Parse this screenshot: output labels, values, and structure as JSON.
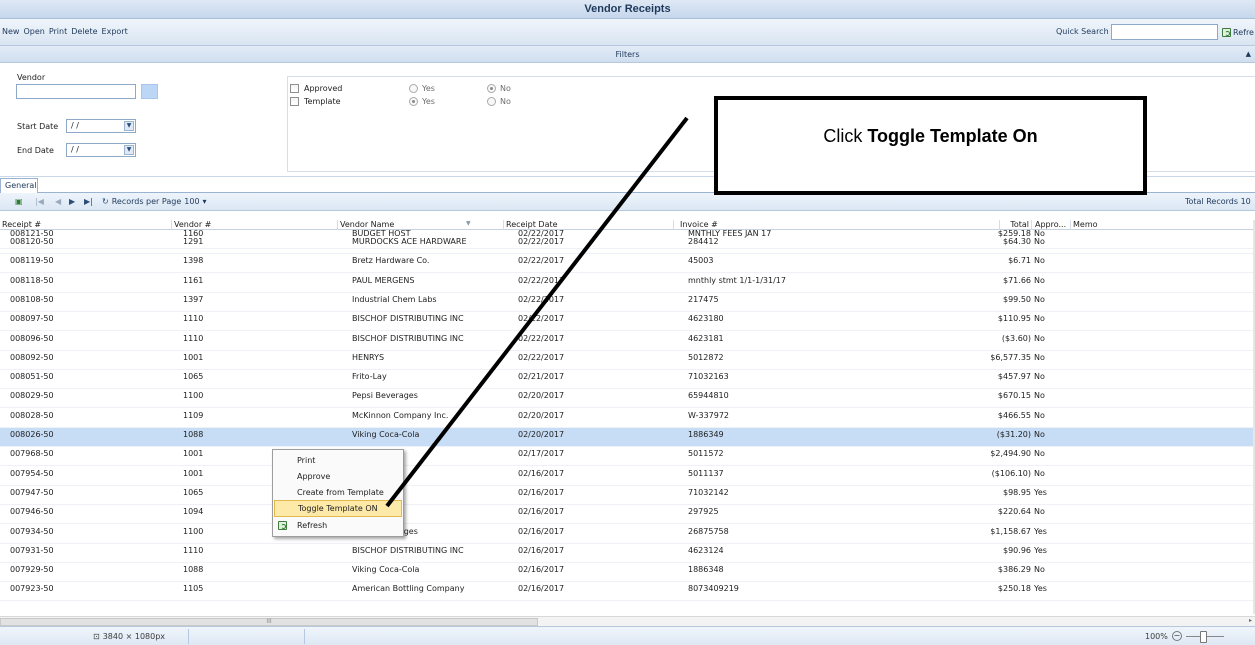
{
  "window": {
    "title": "Vendor Receipts"
  },
  "toolbar": {
    "menu": [
      "New",
      "Open",
      "Print",
      "Delete",
      "Export"
    ],
    "quick_search_label": "Quick Search",
    "quick_search_value": "",
    "refresh_label": "Refre"
  },
  "filters": {
    "header": "Filters",
    "vendor_label": "Vendor",
    "vendor_value": "",
    "start_date_label": "Start Date",
    "start_date_value": "/ /",
    "end_date_label": "End Date",
    "end_date_value": "/ /",
    "approved": {
      "label": "Approved",
      "checked": false,
      "yes": "Yes",
      "no": "No",
      "selected": "No"
    },
    "template": {
      "label": "Template",
      "checked": false,
      "yes": "Yes",
      "no": "No",
      "selected": "Yes"
    }
  },
  "tabs": [
    "General"
  ],
  "navigator": {
    "records_per_page_label": "Records per Page",
    "records_per_page_value": "100",
    "total_records": "Total Records 10"
  },
  "grid": {
    "columns": [
      "Receipt #",
      "Vendor #",
      "Vendor Name",
      "Receipt Date",
      "Invoice #",
      "Total",
      "Appro...",
      "Memo"
    ],
    "rows": [
      {
        "receipt": "008121-50",
        "vendor_no": "1160",
        "vendor_name": "BUDGET HOST",
        "date": "02/22/2017",
        "invoice": "MNTHLY FEES JAN 17",
        "total": "$259.18",
        "approved": "No"
      },
      {
        "receipt": "008120-50",
        "vendor_no": "1291",
        "vendor_name": "MURDOCKS ACE HARDWARE",
        "date": "02/22/2017",
        "invoice": "284412",
        "total": "$64.30",
        "approved": "No"
      },
      {
        "receipt": "008119-50",
        "vendor_no": "1398",
        "vendor_name": "Bretz Hardware Co.",
        "date": "02/22/2017",
        "invoice": "45003",
        "total": "$6.71",
        "approved": "No"
      },
      {
        "receipt": "008118-50",
        "vendor_no": "1161",
        "vendor_name": "PAUL MERGENS",
        "date": "02/22/2017",
        "invoice": "mnthly stmt 1/1-1/31/17",
        "total": "$71.66",
        "approved": "No"
      },
      {
        "receipt": "008108-50",
        "vendor_no": "1397",
        "vendor_name": "Industrial Chem Labs",
        "date": "02/22/2017",
        "invoice": "217475",
        "total": "$99.50",
        "approved": "No"
      },
      {
        "receipt": "008097-50",
        "vendor_no": "1110",
        "vendor_name": "BISCHOF DISTRIBUTING INC",
        "date": "02/22/2017",
        "invoice": "4623180",
        "total": "$110.95",
        "approved": "No"
      },
      {
        "receipt": "008096-50",
        "vendor_no": "1110",
        "vendor_name": "BISCHOF DISTRIBUTING INC",
        "date": "02/22/2017",
        "invoice": "4623181",
        "total": "($3.60)",
        "approved": "No"
      },
      {
        "receipt": "008092-50",
        "vendor_no": "1001",
        "vendor_name": "HENRYS",
        "date": "02/22/2017",
        "invoice": "5012872",
        "total": "$6,577.35",
        "approved": "No"
      },
      {
        "receipt": "008051-50",
        "vendor_no": "1065",
        "vendor_name": "Frito-Lay",
        "date": "02/21/2017",
        "invoice": "71032163",
        "total": "$457.97",
        "approved": "No"
      },
      {
        "receipt": "008029-50",
        "vendor_no": "1100",
        "vendor_name": "Pepsi Beverages",
        "date": "02/20/2017",
        "invoice": "65944810",
        "total": "$670.15",
        "approved": "No"
      },
      {
        "receipt": "008028-50",
        "vendor_no": "1109",
        "vendor_name": "McKinnon Company Inc.",
        "date": "02/20/2017",
        "invoice": "W-337972",
        "total": "$466.55",
        "approved": "No"
      },
      {
        "receipt": "008026-50",
        "vendor_no": "1088",
        "vendor_name": "Viking Coca-Cola",
        "date": "02/20/2017",
        "invoice": "1886349",
        "total": "($31.20)",
        "approved": "No"
      },
      {
        "receipt": "007968-50",
        "vendor_no": "1001",
        "vendor_name": "",
        "date": "02/17/2017",
        "invoice": "5011572",
        "total": "$2,494.90",
        "approved": "No"
      },
      {
        "receipt": "007954-50",
        "vendor_no": "1001",
        "vendor_name": "",
        "date": "02/16/2017",
        "invoice": "5011137",
        "total": "($106.10)",
        "approved": "No"
      },
      {
        "receipt": "007947-50",
        "vendor_no": "1065",
        "vendor_name": "",
        "date": "02/16/2017",
        "invoice": "71032142",
        "total": "$98.95",
        "approved": "Yes"
      },
      {
        "receipt": "007946-50",
        "vendor_no": "1094",
        "vendor_name": "",
        "date": "02/16/2017",
        "invoice": "297925",
        "total": "$220.64",
        "approved": "No"
      },
      {
        "receipt": "007934-50",
        "vendor_no": "1100",
        "vendor_name": "Pepsi Beverages",
        "date": "02/16/2017",
        "invoice": "26875758",
        "total": "$1,158.67",
        "approved": "Yes"
      },
      {
        "receipt": "007931-50",
        "vendor_no": "1110",
        "vendor_name": "BISCHOF DISTRIBUTING INC",
        "date": "02/16/2017",
        "invoice": "4623124",
        "total": "$90.96",
        "approved": "Yes"
      },
      {
        "receipt": "007929-50",
        "vendor_no": "1088",
        "vendor_name": "Viking Coca-Cola",
        "date": "02/16/2017",
        "invoice": "1886348",
        "total": "$386.29",
        "approved": "No"
      },
      {
        "receipt": "007923-50",
        "vendor_no": "1105",
        "vendor_name": "American Bottling Company",
        "date": "02/16/2017",
        "invoice": "8073409219",
        "total": "$250.18",
        "approved": "Yes"
      }
    ],
    "selected_row": "008026-50"
  },
  "context_menu": {
    "items": [
      "Print",
      "Approve",
      "Create from Template",
      "Toggle Template ON",
      "Refresh"
    ],
    "highlighted": "Toggle Template ON"
  },
  "callout": {
    "prefix": "Click ",
    "bold": "Toggle Template On"
  },
  "statusbar": {
    "resolution": "3840 × 1080px",
    "zoom": "100%"
  },
  "colors": {
    "selection": "#c7dcf5",
    "menu_highlight": "#fde9a8",
    "header_text": "#1e395b"
  }
}
